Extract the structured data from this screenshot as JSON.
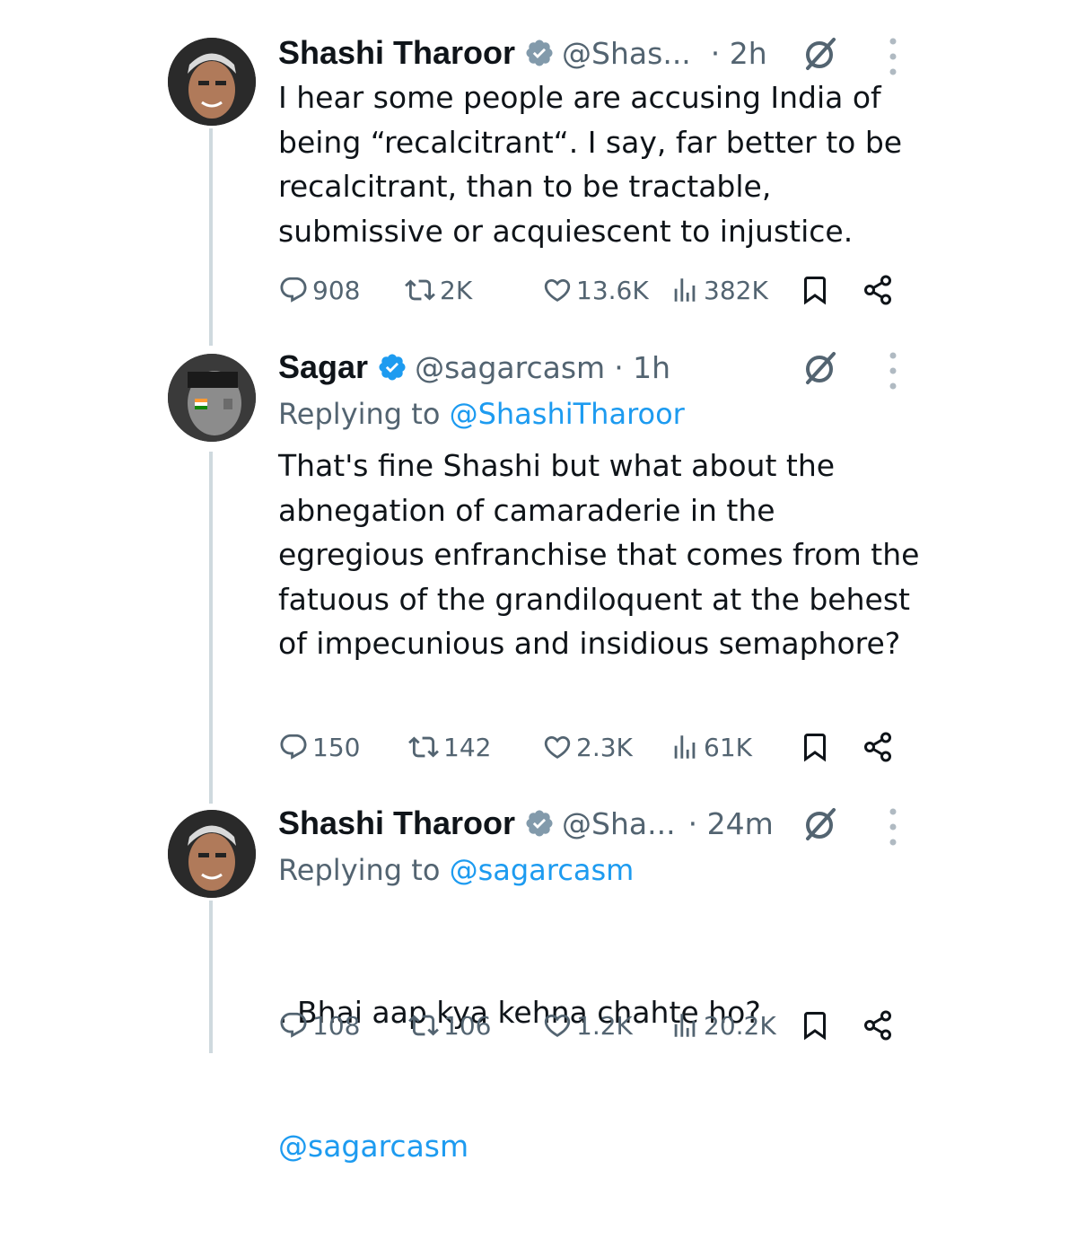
{
  "tweets": [
    {
      "name": "Shashi Tharoor",
      "handle": "@Shas...",
      "time": "· 2h",
      "replying_prefix": "",
      "replying_handle": "",
      "text": "I hear some people are accusing India of being “recalcitrant“. I say, far better to be recalcitrant, than to be tractable, submissive or acquiescent to injustice.",
      "replies": "908",
      "reposts": "2K",
      "likes": "13.6K",
      "views": "382K",
      "badge_color": "#829aab"
    },
    {
      "name": "Sagar",
      "handle": "@sagarcasm",
      "time": "· 1h",
      "replying_prefix": "Replying to ",
      "replying_handle": "@ShashiTharoor",
      "text": "That's fine Shashi but what about the abnegation of camaraderie in the egregious enfranchise that comes from the fatuous of the grandiloquent at the behest of impecunious and insidious semaphore?",
      "replies": "150",
      "reposts": "142",
      "likes": "2.3K",
      "views": "61K",
      "badge_color": "#1d9bf0"
    },
    {
      "name": "Shashi Tharoor",
      "handle": "@Sha...",
      "time": "· 24m",
      "replying_prefix": "Replying to ",
      "replying_handle": "@sagarcasm",
      "text": ". Bhai aap kya kehna chahte ho?",
      "text_mention": "@sagarcasm",
      "replies": "108",
      "reposts": "106",
      "likes": "1.2K",
      "views": "20.2K",
      "badge_color": "#829aab"
    }
  ],
  "icons": [
    "verified-badge-icon",
    "grok-icon",
    "more-icon",
    "reply-icon",
    "repost-icon",
    "like-icon",
    "views-icon",
    "bookmark-icon",
    "share-icon"
  ],
  "colors": {
    "text": "#0f1419",
    "muted": "#536471",
    "link": "#1d9bf0",
    "thread_line": "#cfd9de"
  }
}
